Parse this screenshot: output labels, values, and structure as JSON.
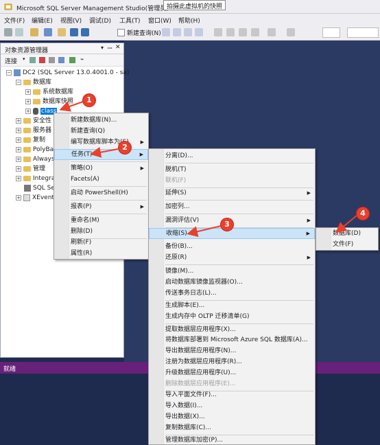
{
  "window": {
    "title": "Microsoft SQL Server Management Studio(管理员)",
    "tooltip": "拍摄此虚拟机的快照"
  },
  "menubar": [
    "文件(F)",
    "编辑(E)",
    "视图(V)",
    "调试(D)",
    "工具(T)",
    "窗口(W)",
    "帮助(H)"
  ],
  "toolbar": {
    "new_query": "新建查询(N)"
  },
  "object_explorer": {
    "title": "对象资源管理器",
    "connect": "连接",
    "server": "DC2 (SQL Server 13.0.4001.0 - sa)",
    "nodes": {
      "databases": "数据库",
      "system_db": "系统数据库",
      "db_snapshots": "数据库快照",
      "class_db": "class",
      "security": "安全性",
      "server_objects": "服务器",
      "replication": "复制",
      "polybase": "PolyBa",
      "always_on": "Always",
      "management": "管理",
      "integration": "Integra",
      "sql_agent": "SQL Se",
      "xevent": "XEvent"
    }
  },
  "status": "就绪",
  "menu1": {
    "items": [
      "新建数据库(N)...",
      "新建查询(Q)",
      "编写数据库脚本为(S)",
      "任务(T)",
      "策略(O)",
      "Facets(A)",
      "启动 PowerShell(H)",
      "报表(P)",
      "重命名(M)",
      "删除(D)",
      "刷新(F)",
      "属性(R)"
    ]
  },
  "menu2": {
    "items": [
      "分离(D)...",
      "脱机(T)",
      "联机(F)",
      "延伸(S)",
      "加密列...",
      "漏洞评估(V)",
      "收缩(S)",
      "备份(B)...",
      "还原(R)",
      "镜像(M)...",
      "启动数据库镜像监视器(O)...",
      "传送事务日志(L)...",
      "生成脚本(E)...",
      "生成内存中 OLTP 迁移清单(G)",
      "提取数据层应用程序(X)...",
      "将数据库部署到 Microsoft Azure SQL 数据库(A)...",
      "导出数据层应用程序(N)...",
      "注册为数据层应用程序(R)...",
      "升级数据层应用程序(U)...",
      "删除数据层应用程序(E)...",
      "导入平面文件(F)...",
      "导入数据(I)...",
      "导出数据(X)...",
      "复制数据库(C)...",
      "管理数据库加密(P)..."
    ]
  },
  "menu3": {
    "items": [
      "数据库(D)",
      "文件(F)"
    ]
  },
  "badges": [
    "1",
    "2",
    "3",
    "4"
  ],
  "colors": {
    "accent": "#0078d7",
    "status_bar": "#68217a",
    "annotation": "#e8412c",
    "dock": "#2b3a62"
  }
}
